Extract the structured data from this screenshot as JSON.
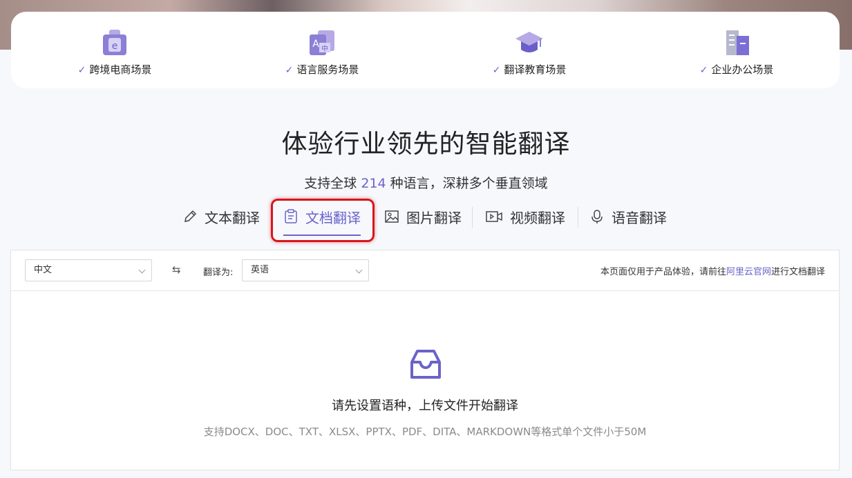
{
  "scenes": [
    {
      "label": "跨境电商场景",
      "icon": "shopping-bag-e-icon"
    },
    {
      "label": "语言服务场景",
      "icon": "translate-a-zh-icon"
    },
    {
      "label": "翻译教育场景",
      "icon": "graduation-cap-icon"
    },
    {
      "label": "企业办公场景",
      "icon": "office-building-icon"
    }
  ],
  "title": "体验行业领先的智能翻译",
  "subtitle": {
    "prefix": "支持全球",
    "count": "214",
    "suffix": "种语言，深耕多个垂直领域"
  },
  "tabs": [
    {
      "label": "文本翻译",
      "icon": "pencil-icon"
    },
    {
      "label": "文档翻译",
      "icon": "document-icon",
      "active": true
    },
    {
      "label": "图片翻译",
      "icon": "image-icon"
    },
    {
      "label": "视频翻译",
      "icon": "video-icon"
    },
    {
      "label": "语音翻译",
      "icon": "microphone-icon"
    }
  ],
  "toolbar": {
    "source_lang": "中文",
    "swap_symbol": "⇆",
    "target_label": "翻译为:",
    "target_lang": "英语",
    "notice_prefix": "本页面仅用于产品体验，请前往",
    "notice_link": "阿里云官网",
    "notice_suffix": "进行文档翻译"
  },
  "empty": {
    "title": "请先设置语种，上传文件开始翻译",
    "description": "支持DOCX、DOC、TXT、XLSX、PPTX、PDF、DITA、MARKDOWN等格式单个文件小于50M"
  },
  "colors": {
    "accent": "#6a63c9",
    "highlight": "#d8151b"
  }
}
